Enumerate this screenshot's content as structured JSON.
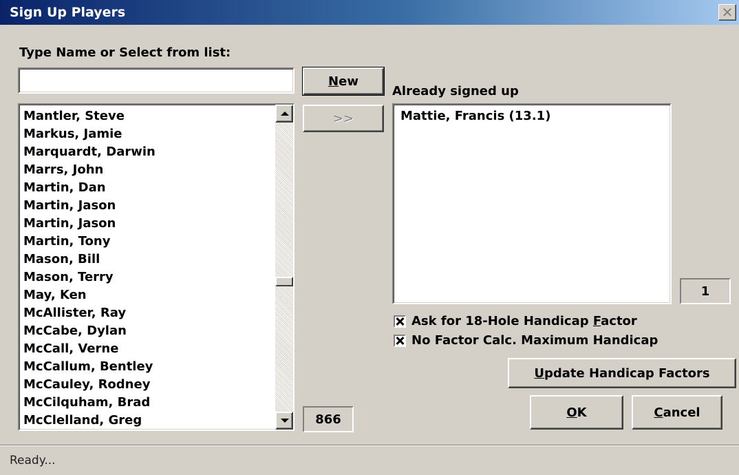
{
  "window": {
    "title": "Sign Up Players"
  },
  "left": {
    "prompt_label": "Type Name or Select from list:",
    "name_input_value": "",
    "players": [
      "Mantler, Steve",
      "Markus, Jamie",
      "Marquardt, Darwin",
      "Marrs, John",
      "Martin, Dan",
      "Martin, Jason",
      "Martin, Jason",
      "Martin, Tony",
      "Mason, Bill",
      "Mason, Terry",
      "May, Ken",
      "McAllister, Ray",
      "McCabe, Dylan",
      "McCall, Verne",
      "McCallum, Bentley",
      "McCauley, Rodney",
      "McCilquham, Brad",
      "McClelland, Greg"
    ],
    "player_count": "866"
  },
  "middle": {
    "new_button": {
      "accel": "N",
      "rest": "ew"
    },
    "add_button_label": ">>"
  },
  "right": {
    "signed_up_label": "Already signed up",
    "signed_up": [
      "Mattie, Francis (13.1)"
    ],
    "signed_up_count": "1",
    "ask_factor": {
      "checked": true,
      "pre": "Ask for 18-Hole Handicap ",
      "accel": "F",
      "post": "actor"
    },
    "no_factor": {
      "checked": true,
      "label": "No Factor Calc. Maximum Handicap"
    },
    "update_button": {
      "accel": "U",
      "rest": "pdate Handicap Factors"
    },
    "ok_button": {
      "accel": "O",
      "rest": "K"
    },
    "cancel_button": {
      "accel": "C",
      "rest": "ancel"
    }
  },
  "status": {
    "text": "Ready..."
  }
}
